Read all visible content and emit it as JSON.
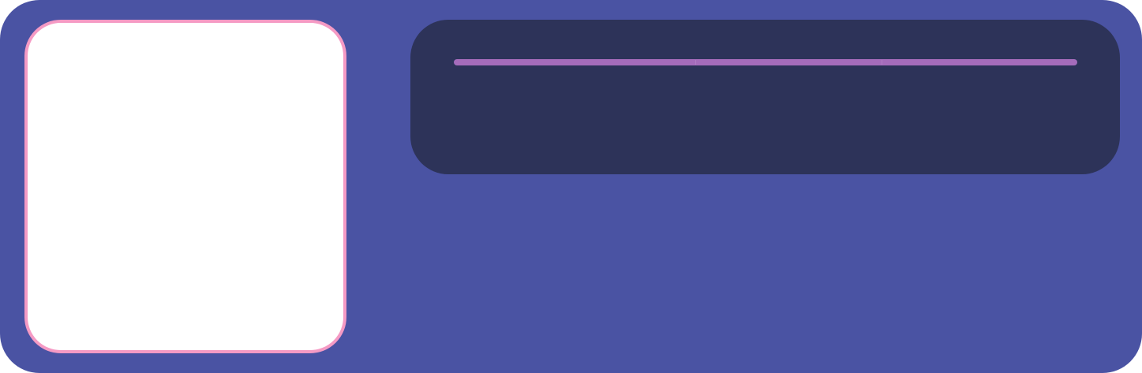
{
  "colors": {
    "card_background": "#4a53a3",
    "avatar_border": "#f59ac4",
    "avatar_fill": "#ffffff",
    "panel_background": "#2d3359",
    "progress_track": "#585a9b",
    "progress_fill": "#a56cbb"
  },
  "progress": {
    "value": 1.0,
    "segments": 3
  }
}
